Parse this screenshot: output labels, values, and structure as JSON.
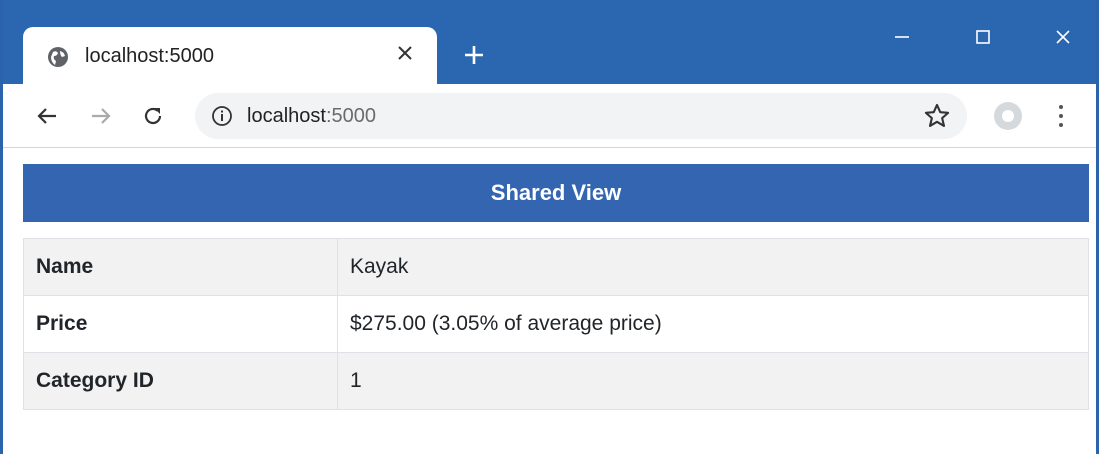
{
  "browser": {
    "tab_title": "localhost:5000",
    "url_host": "localhost",
    "url_port": ":5000",
    "accent_color": "#2b66b0"
  },
  "icons": {
    "favicon": "globe-icon",
    "tab_close": "close-icon",
    "new_tab": "plus-icon",
    "minimize": "minimize-icon",
    "maximize": "maximize-icon",
    "close_window": "close-icon",
    "back": "arrow-left-icon",
    "forward": "arrow-right-icon",
    "reload": "reload-icon",
    "site_info": "info-icon",
    "bookmark": "star-icon",
    "profile": "profile-icon",
    "menu": "kebab-menu-icon"
  },
  "page": {
    "banner_title": "Shared View",
    "banner_color": "#3465b0",
    "rows": [
      {
        "label": "Name",
        "value": "Kayak"
      },
      {
        "label": "Price",
        "value": "$275.00 (3.05% of average price)"
      },
      {
        "label": "Category ID",
        "value": "1"
      }
    ]
  }
}
